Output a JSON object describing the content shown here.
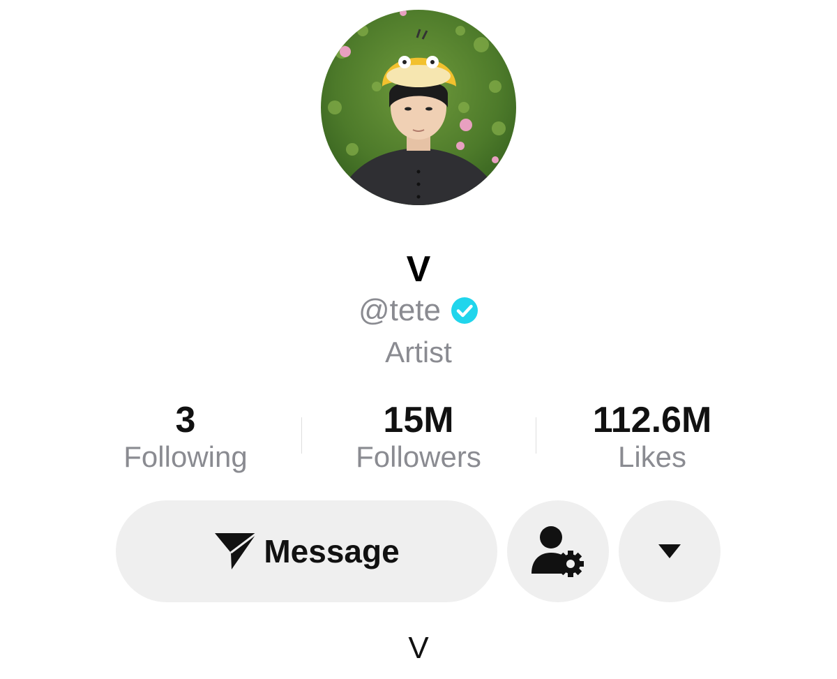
{
  "profile": {
    "display_name": "V",
    "handle": "@tete",
    "verified": true,
    "bio": "Artist",
    "footer_text": "V"
  },
  "stats": [
    {
      "value": "3",
      "label": "Following"
    },
    {
      "value": "15M",
      "label": "Followers"
    },
    {
      "value": "112.6M",
      "label": "Likes"
    }
  ],
  "actions": {
    "message_label": "Message",
    "message_icon": "send-icon",
    "friend_icon": "user-settings-icon",
    "more_icon": "caret-down-icon"
  },
  "colors": {
    "verified_badge": "#20d5ec",
    "secondary_text": "#8a8b91",
    "button_bg": "#efefef"
  }
}
